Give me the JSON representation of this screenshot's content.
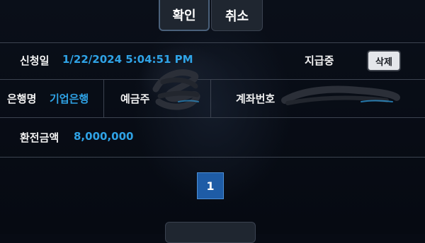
{
  "toolbar": {
    "confirm_label": "확인",
    "cancel_label": "취소"
  },
  "request": {
    "date_label": "신청일",
    "date_value": "1/22/2024 5:04:51 PM",
    "status": "지급중",
    "delete_label": "삭제"
  },
  "account": {
    "bank_label": "은행명",
    "bank_value": "기업은행",
    "holder_label": "예금주",
    "number_label": "계좌번호"
  },
  "exchange": {
    "amount_label": "환전금액",
    "amount_value": "8,000,000"
  },
  "pagination": {
    "current_page": "1"
  },
  "colors": {
    "value_blue": "#2fa3e6",
    "page_active": "#1e5ca6",
    "divider": "#3c4350"
  }
}
